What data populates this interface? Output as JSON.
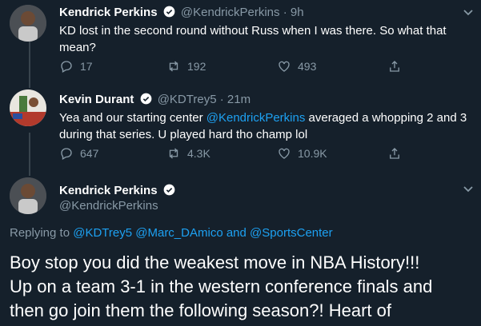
{
  "tweets": [
    {
      "name": "Kendrick Perkins",
      "handle": "@KendrickPerkins",
      "time": "· 9h",
      "text": "KD lost in the second round without Russ when I was there. So what that mean?",
      "replies": "17",
      "retweets": "192",
      "likes": "493"
    },
    {
      "name": "Kevin Durant",
      "handle": "@KDTrey5",
      "time": "· 21m",
      "text_before": "Yea and our starting center ",
      "mention": "@KendrickPerkins",
      "text_after": " averaged a whopping 2 and 3 during that series. U played hard tho champ lol",
      "replies": "647",
      "retweets": "4.3K",
      "likes": "10.9K"
    }
  ],
  "focused": {
    "name": "Kendrick Perkins",
    "handle": "@KendrickPerkins",
    "replying_prefix": "Replying to",
    "reply_mention_1": "@KDTrey5",
    "reply_mention_2": "@Marc_DAmico",
    "reply_and": "and",
    "reply_mention_3": "@SportsCenter",
    "text_line_1": "Boy stop you did the weakest move in NBA History!!!",
    "text_line_2": "Up on a team 3-1 in the western conference finals and",
    "text_line_3": "then go join them the following season?! Heart of"
  },
  "colors": {
    "background": "#15202b",
    "muted": "#8899a6",
    "link": "#1da1f2",
    "like_icon": "heart-icon"
  }
}
